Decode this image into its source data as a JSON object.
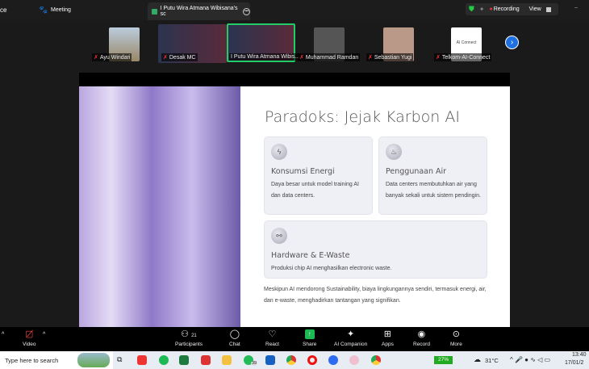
{
  "topbar": {
    "app_partial": "ce",
    "meeting_label": "Meeting",
    "tab_title": "I Putu Wira Atmana Wibisana's sc",
    "recording": "Recording",
    "view": "View"
  },
  "participants": [
    {
      "name": "Ayu Windari"
    },
    {
      "name": "Desak MC"
    },
    {
      "name": "I Putu Wira Atmana Wibis..."
    },
    {
      "name": "Muhammad Ramdan"
    },
    {
      "name": "Sebastian Yugi"
    },
    {
      "name": "Telkom-AI-Connect",
      "tile_text": "AI Connect"
    }
  ],
  "slide": {
    "title": "Paradoks: Jejak Karbon AI",
    "cards": [
      {
        "icon": "lightning-icon",
        "heading": "Konsumsi Energi",
        "desc": "Daya besar untuk model training AI dan data centers."
      },
      {
        "icon": "water-icon",
        "heading": "Penggunaan Air",
        "desc": "Data centers membutuhkan air yang banyak sekali untuk sistem pendingin."
      },
      {
        "icon": "chip-network-icon",
        "heading": "Hardware & E-Waste",
        "desc": "Produksi chip AI menghasilkan electronic waste."
      }
    ],
    "note": "Meskipun AI mendorong Sustainability, biaya lingkungannya sendiri, termasuk energi, air, dan e-waste, menghadirkan tantangan yang signifikan."
  },
  "toolbar": {
    "video": "Video",
    "participants": "Participants",
    "participants_count": "21",
    "chat": "Chat",
    "react": "React",
    "share": "Share",
    "ai": "AI Companion",
    "apps": "Apps",
    "record": "Record",
    "more": "More",
    "share_color": "#1db954"
  },
  "taskbar": {
    "search_placeholder": "Type here to search",
    "whatsapp_badge": "39",
    "battery": "27%",
    "weather": "31°C",
    "time": "13:40",
    "date": "17/01/2"
  }
}
